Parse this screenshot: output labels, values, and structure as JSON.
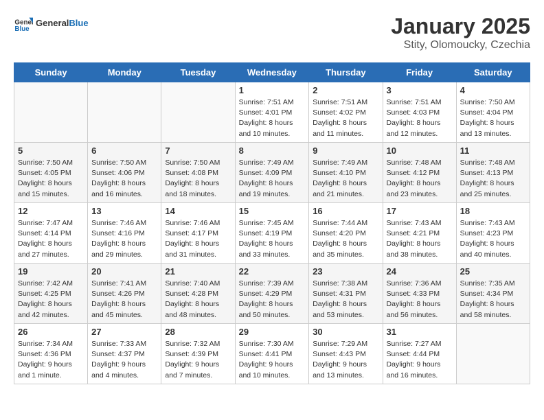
{
  "header": {
    "logo_general": "General",
    "logo_blue": "Blue",
    "title": "January 2025",
    "subtitle": "Stity, Olomoucky, Czechia"
  },
  "weekdays": [
    "Sunday",
    "Monday",
    "Tuesday",
    "Wednesday",
    "Thursday",
    "Friday",
    "Saturday"
  ],
  "weeks": [
    [
      {
        "day": "",
        "info": ""
      },
      {
        "day": "",
        "info": ""
      },
      {
        "day": "",
        "info": ""
      },
      {
        "day": "1",
        "info": "Sunrise: 7:51 AM\nSunset: 4:01 PM\nDaylight: 8 hours and 10 minutes."
      },
      {
        "day": "2",
        "info": "Sunrise: 7:51 AM\nSunset: 4:02 PM\nDaylight: 8 hours and 11 minutes."
      },
      {
        "day": "3",
        "info": "Sunrise: 7:51 AM\nSunset: 4:03 PM\nDaylight: 8 hours and 12 minutes."
      },
      {
        "day": "4",
        "info": "Sunrise: 7:50 AM\nSunset: 4:04 PM\nDaylight: 8 hours and 13 minutes."
      }
    ],
    [
      {
        "day": "5",
        "info": "Sunrise: 7:50 AM\nSunset: 4:05 PM\nDaylight: 8 hours and 15 minutes."
      },
      {
        "day": "6",
        "info": "Sunrise: 7:50 AM\nSunset: 4:06 PM\nDaylight: 8 hours and 16 minutes."
      },
      {
        "day": "7",
        "info": "Sunrise: 7:50 AM\nSunset: 4:08 PM\nDaylight: 8 hours and 18 minutes."
      },
      {
        "day": "8",
        "info": "Sunrise: 7:49 AM\nSunset: 4:09 PM\nDaylight: 8 hours and 19 minutes."
      },
      {
        "day": "9",
        "info": "Sunrise: 7:49 AM\nSunset: 4:10 PM\nDaylight: 8 hours and 21 minutes."
      },
      {
        "day": "10",
        "info": "Sunrise: 7:48 AM\nSunset: 4:12 PM\nDaylight: 8 hours and 23 minutes."
      },
      {
        "day": "11",
        "info": "Sunrise: 7:48 AM\nSunset: 4:13 PM\nDaylight: 8 hours and 25 minutes."
      }
    ],
    [
      {
        "day": "12",
        "info": "Sunrise: 7:47 AM\nSunset: 4:14 PM\nDaylight: 8 hours and 27 minutes."
      },
      {
        "day": "13",
        "info": "Sunrise: 7:46 AM\nSunset: 4:16 PM\nDaylight: 8 hours and 29 minutes."
      },
      {
        "day": "14",
        "info": "Sunrise: 7:46 AM\nSunset: 4:17 PM\nDaylight: 8 hours and 31 minutes."
      },
      {
        "day": "15",
        "info": "Sunrise: 7:45 AM\nSunset: 4:19 PM\nDaylight: 8 hours and 33 minutes."
      },
      {
        "day": "16",
        "info": "Sunrise: 7:44 AM\nSunset: 4:20 PM\nDaylight: 8 hours and 35 minutes."
      },
      {
        "day": "17",
        "info": "Sunrise: 7:43 AM\nSunset: 4:21 PM\nDaylight: 8 hours and 38 minutes."
      },
      {
        "day": "18",
        "info": "Sunrise: 7:43 AM\nSunset: 4:23 PM\nDaylight: 8 hours and 40 minutes."
      }
    ],
    [
      {
        "day": "19",
        "info": "Sunrise: 7:42 AM\nSunset: 4:25 PM\nDaylight: 8 hours and 42 minutes."
      },
      {
        "day": "20",
        "info": "Sunrise: 7:41 AM\nSunset: 4:26 PM\nDaylight: 8 hours and 45 minutes."
      },
      {
        "day": "21",
        "info": "Sunrise: 7:40 AM\nSunset: 4:28 PM\nDaylight: 8 hours and 48 minutes."
      },
      {
        "day": "22",
        "info": "Sunrise: 7:39 AM\nSunset: 4:29 PM\nDaylight: 8 hours and 50 minutes."
      },
      {
        "day": "23",
        "info": "Sunrise: 7:38 AM\nSunset: 4:31 PM\nDaylight: 8 hours and 53 minutes."
      },
      {
        "day": "24",
        "info": "Sunrise: 7:36 AM\nSunset: 4:33 PM\nDaylight: 8 hours and 56 minutes."
      },
      {
        "day": "25",
        "info": "Sunrise: 7:35 AM\nSunset: 4:34 PM\nDaylight: 8 hours and 58 minutes."
      }
    ],
    [
      {
        "day": "26",
        "info": "Sunrise: 7:34 AM\nSunset: 4:36 PM\nDaylight: 9 hours and 1 minute."
      },
      {
        "day": "27",
        "info": "Sunrise: 7:33 AM\nSunset: 4:37 PM\nDaylight: 9 hours and 4 minutes."
      },
      {
        "day": "28",
        "info": "Sunrise: 7:32 AM\nSunset: 4:39 PM\nDaylight: 9 hours and 7 minutes."
      },
      {
        "day": "29",
        "info": "Sunrise: 7:30 AM\nSunset: 4:41 PM\nDaylight: 9 hours and 10 minutes."
      },
      {
        "day": "30",
        "info": "Sunrise: 7:29 AM\nSunset: 4:43 PM\nDaylight: 9 hours and 13 minutes."
      },
      {
        "day": "31",
        "info": "Sunrise: 7:27 AM\nSunset: 4:44 PM\nDaylight: 9 hours and 16 minutes."
      },
      {
        "day": "",
        "info": ""
      }
    ]
  ]
}
